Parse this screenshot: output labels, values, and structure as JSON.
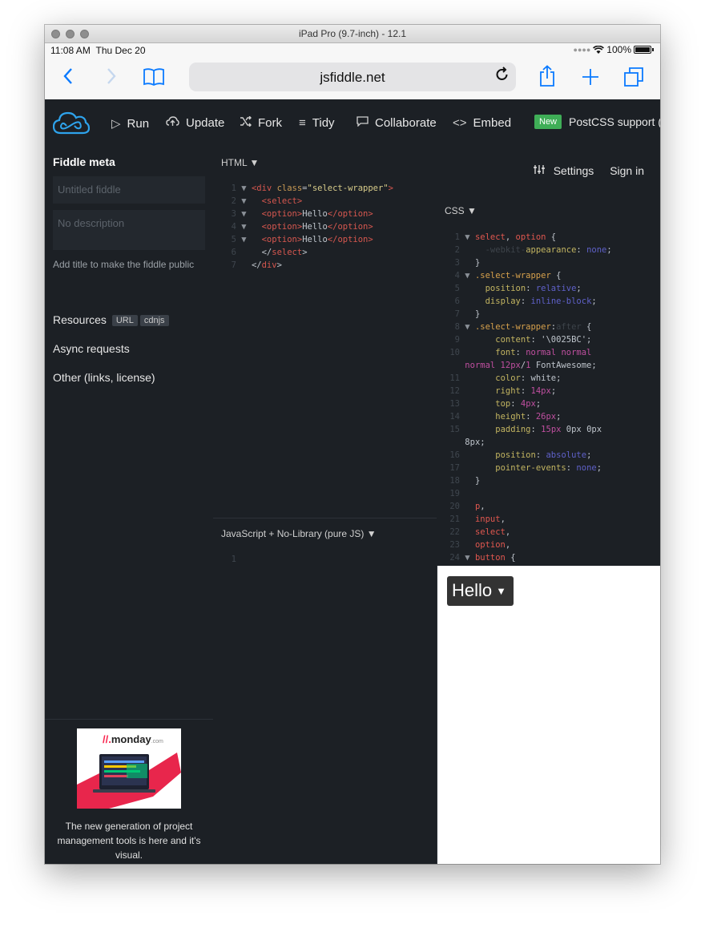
{
  "window": {
    "title": "iPad Pro (9.7-inch) - 12.1"
  },
  "status": {
    "time": "11:08 AM",
    "date": "Thu Dec 20",
    "battery": "100%"
  },
  "browser": {
    "url": "jsfiddle.net"
  },
  "toolbar": {
    "run": "Run",
    "update": "Update",
    "fork": "Fork",
    "tidy": "Tidy",
    "collaborate": "Collaborate",
    "embed": "Embed",
    "new_badge": "New",
    "postcss": "PostCSS support (",
    "settings": "Settings",
    "sign_in": "Sign in"
  },
  "sidebar": {
    "title": "Fiddle meta",
    "title_placeholder": "Untitled fiddle",
    "description_placeholder": "No description",
    "hint": "Add title to make the fiddle public",
    "resources": "Resources",
    "resources_tags": [
      "URL",
      "cdnjs"
    ],
    "async": "Async requests",
    "other": "Other (links, license)",
    "ad": {
      "brand": "monday",
      "brand_suffix": ".com",
      "text": "The new generation of project management tools is here and it's visual."
    }
  },
  "panes": {
    "html_label": "HTML ▼",
    "js_label": "JavaScript + No-Library (pure JS) ▼",
    "css_label": "CSS ▼"
  },
  "html_code": [
    {
      "n": "1",
      "a": "▼ ",
      "i": "",
      "parts": [
        [
          "tg",
          "<div "
        ],
        [
          "at",
          "class"
        ],
        [
          "tx",
          "="
        ],
        [
          "st",
          "\"select-wrapper\""
        ],
        [
          "tg",
          ">"
        ]
      ]
    },
    {
      "n": "2",
      "a": "▼ ",
      "i": "  ",
      "parts": [
        [
          "tg",
          "<select>"
        ]
      ]
    },
    {
      "n": "3",
      "a": "▼ ",
      "i": "  ",
      "parts": [
        [
          "tg",
          "<option>"
        ],
        [
          "tx",
          "Hello"
        ],
        [
          "tg",
          "</option>"
        ]
      ]
    },
    {
      "n": "4",
      "a": "▼ ",
      "i": "  ",
      "parts": [
        [
          "tg",
          "<option>"
        ],
        [
          "tx",
          "Hello"
        ],
        [
          "tg",
          "</option>"
        ]
      ]
    },
    {
      "n": "5",
      "a": "▼ ",
      "i": "  ",
      "parts": [
        [
          "tg",
          "<option>"
        ],
        [
          "tx",
          "Hello"
        ],
        [
          "tg",
          "</option>"
        ]
      ]
    },
    {
      "n": "6",
      "a": "  ",
      "i": "  ",
      "parts": [
        [
          "tx",
          "</"
        ],
        [
          "tg",
          "select"
        ],
        [
          "tx",
          ">"
        ]
      ]
    },
    {
      "n": "7",
      "a": "  ",
      "i": "",
      "parts": [
        [
          "tx",
          "</"
        ],
        [
          "tg",
          "div"
        ],
        [
          "tx",
          ">"
        ]
      ]
    }
  ],
  "js_code": [
    {
      "n": "1",
      "a": "  ",
      "i": "",
      "parts": []
    }
  ],
  "css_code": [
    {
      "n": "1",
      "a": "▼ ",
      "i": "",
      "parts": [
        [
          "sel",
          "select"
        ],
        [
          "tx",
          ", "
        ],
        [
          "sel",
          "option"
        ],
        [
          "tx",
          " {"
        ]
      ]
    },
    {
      "n": "2",
      "a": "  ",
      "i": "  ",
      "parts": [
        [
          "dim",
          "-webkit-"
        ],
        [
          "prop",
          "appearance"
        ],
        [
          "tx",
          ": "
        ],
        [
          "kw",
          "none"
        ],
        [
          "tx",
          ";"
        ]
      ]
    },
    {
      "n": "3",
      "a": "  ",
      "i": "",
      "parts": [
        [
          "tx",
          "}"
        ]
      ]
    },
    {
      "n": "4",
      "a": "▼ ",
      "i": "",
      "parts": [
        [
          "cls",
          ".select-wrapper"
        ],
        [
          "tx",
          " {"
        ]
      ]
    },
    {
      "n": "5",
      "a": "  ",
      "i": "  ",
      "parts": [
        [
          "prop",
          "position"
        ],
        [
          "tx",
          ": "
        ],
        [
          "kw",
          "relative"
        ],
        [
          "tx",
          ";"
        ]
      ]
    },
    {
      "n": "6",
      "a": "  ",
      "i": "  ",
      "parts": [
        [
          "prop",
          "display"
        ],
        [
          "tx",
          ": "
        ],
        [
          "kw",
          "inline-block"
        ],
        [
          "tx",
          ";"
        ]
      ]
    },
    {
      "n": "7",
      "a": "  ",
      "i": "",
      "parts": [
        [
          "tx",
          "}"
        ]
      ]
    },
    {
      "n": "8",
      "a": "▼ ",
      "i": "",
      "parts": [
        [
          "cls",
          ".select-wrapper"
        ],
        [
          "tx",
          ":"
        ],
        [
          "dim",
          "after"
        ],
        [
          "tx",
          " {"
        ]
      ]
    },
    {
      "n": "9",
      "a": "  ",
      "i": "    ",
      "parts": [
        [
          "prop",
          "content"
        ],
        [
          "tx",
          ": '\\0025BC';"
        ]
      ]
    },
    {
      "n": "10",
      "a": "  ",
      "i": "    ",
      "parts": [
        [
          "prop",
          "font"
        ],
        [
          "tx",
          ": "
        ],
        [
          "num",
          "normal normal"
        ]
      ]
    },
    {
      "n": "",
      "a": "",
      "i": "",
      "parts": [
        [
          "num",
          "normal 12px"
        ],
        [
          "tx",
          "/"
        ],
        [
          "num",
          "1"
        ],
        [
          "tx",
          " FontAwesome;"
        ]
      ]
    },
    {
      "n": "11",
      "a": "  ",
      "i": "    ",
      "parts": [
        [
          "prop",
          "color"
        ],
        [
          "tx",
          ": white;"
        ]
      ]
    },
    {
      "n": "12",
      "a": "  ",
      "i": "    ",
      "parts": [
        [
          "prop",
          "right"
        ],
        [
          "tx",
          ": "
        ],
        [
          "num",
          "14px"
        ],
        [
          "tx",
          ";"
        ]
      ]
    },
    {
      "n": "13",
      "a": "  ",
      "i": "    ",
      "parts": [
        [
          "prop",
          "top"
        ],
        [
          "tx",
          ": "
        ],
        [
          "num",
          "4px"
        ],
        [
          "tx",
          ";"
        ]
      ]
    },
    {
      "n": "14",
      "a": "  ",
      "i": "    ",
      "parts": [
        [
          "prop",
          "height"
        ],
        [
          "tx",
          ": "
        ],
        [
          "num",
          "26px"
        ],
        [
          "tx",
          ";"
        ]
      ]
    },
    {
      "n": "15",
      "a": "  ",
      "i": "    ",
      "parts": [
        [
          "prop",
          "padding"
        ],
        [
          "tx",
          ": "
        ],
        [
          "num",
          "15px"
        ],
        [
          "tx",
          " 0px 0px"
        ]
      ]
    },
    {
      "n": "",
      "a": "",
      "i": "",
      "parts": [
        [
          "tx",
          "8px;"
        ]
      ]
    },
    {
      "n": "16",
      "a": "  ",
      "i": "    ",
      "parts": [
        [
          "prop",
          "position"
        ],
        [
          "tx",
          ": "
        ],
        [
          "kw",
          "absolute"
        ],
        [
          "tx",
          ";"
        ]
      ]
    },
    {
      "n": "17",
      "a": "  ",
      "i": "    ",
      "parts": [
        [
          "prop",
          "pointer-events"
        ],
        [
          "tx",
          ": "
        ],
        [
          "kw",
          "none"
        ],
        [
          "tx",
          ";"
        ]
      ]
    },
    {
      "n": "18",
      "a": "  ",
      "i": "",
      "parts": [
        [
          "tx",
          "}"
        ]
      ]
    },
    {
      "n": "19",
      "a": "  ",
      "i": "",
      "parts": []
    },
    {
      "n": "20",
      "a": "  ",
      "i": "",
      "parts": [
        [
          "sel",
          "p"
        ],
        [
          "tx",
          ","
        ]
      ]
    },
    {
      "n": "21",
      "a": "  ",
      "i": "",
      "parts": [
        [
          "sel",
          "input"
        ],
        [
          "tx",
          ","
        ]
      ]
    },
    {
      "n": "22",
      "a": "  ",
      "i": "",
      "parts": [
        [
          "sel",
          "select"
        ],
        [
          "tx",
          ","
        ]
      ]
    },
    {
      "n": "23",
      "a": "  ",
      "i": "",
      "parts": [
        [
          "sel",
          "option"
        ],
        [
          "tx",
          ","
        ]
      ]
    },
    {
      "n": "24",
      "a": "▼ ",
      "i": "",
      "parts": [
        [
          "sel",
          "button"
        ],
        [
          "tx",
          " {"
        ]
      ]
    }
  ],
  "result": {
    "select_value": "Hello",
    "arrow": "▼"
  },
  "colors": {
    "editor_bg": "#1c2025",
    "accent_blue": "#0a7aff",
    "new_badge": "#3fae57"
  }
}
